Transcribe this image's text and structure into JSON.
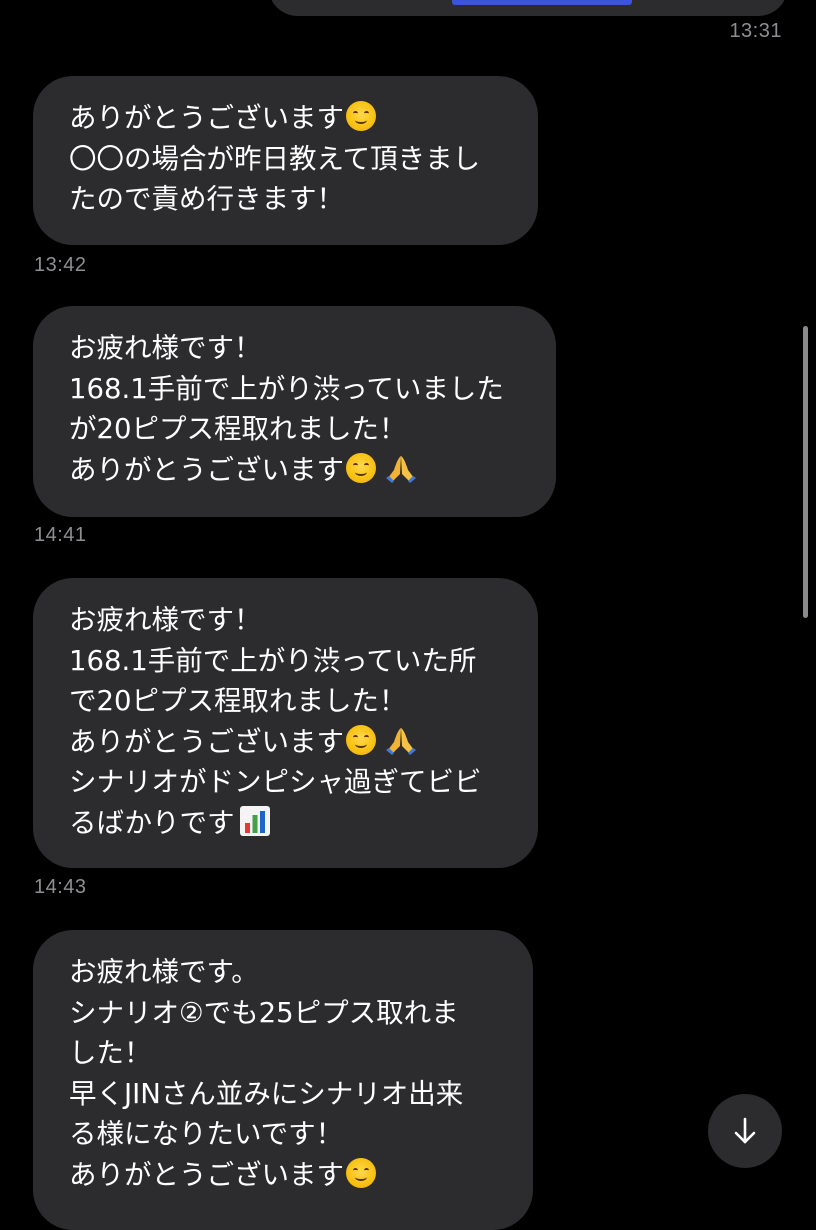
{
  "top_message": {
    "timestamp": "13:31"
  },
  "messages": [
    {
      "lines": [
        "ありがとうございます",
        "〇〇の場合が昨日教えて頂きまし",
        "たので責め行きます！"
      ],
      "timestamp": "13:42"
    },
    {
      "lines": [
        "お疲れ様です！",
        "168.1手前で上がり渋っていました",
        "が20ピプス程取れました！",
        "ありがとうございます"
      ],
      "timestamp": "14:41"
    },
    {
      "lines": [
        "お疲れ様です！",
        "168.1手前で上がり渋っていた所",
        "で20ピプス程取れました！",
        "ありがとうございます",
        "シナリオがドンピシャ過ぎてビビ",
        "るばかりです"
      ],
      "timestamp": "14:43"
    },
    {
      "lines": [
        "お疲れ様です。",
        "シナリオ②でも25ピプス取れま",
        "した！",
        "早くJINさん並みにシナリオ出来",
        "る様になりたいです！",
        "ありがとうございます"
      ]
    }
  ],
  "icons": {
    "smile": "smiling-face-emoji",
    "pray": "folded-hands-emoji",
    "chart": "bar-chart-emoji",
    "scroll_down": "arrow-down-icon"
  },
  "colors": {
    "background": "#000000",
    "bubble": "#2c2c2e",
    "timestamp": "#8e8e93",
    "text": "#ffffff"
  }
}
